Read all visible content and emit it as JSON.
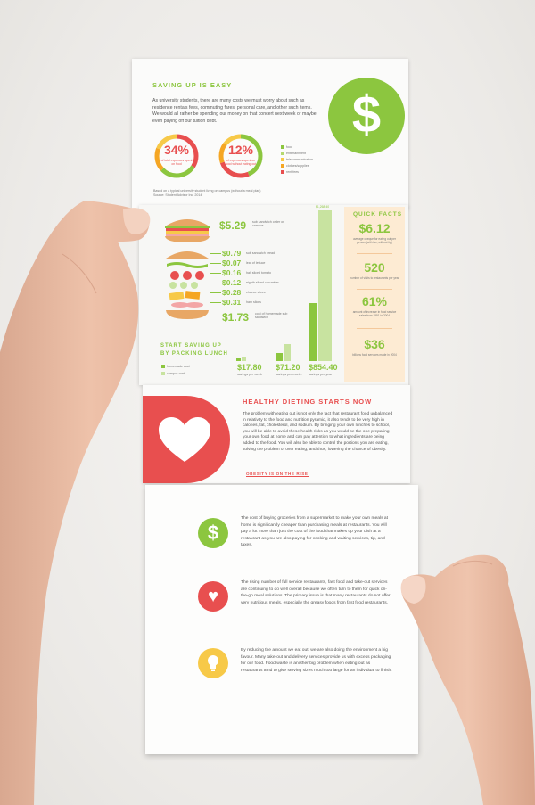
{
  "colors": {
    "green": "#8cc63f",
    "red": "#e84f4f",
    "orange": "#f5a623",
    "yellow": "#f7c948",
    "peach": "#fdebd3"
  },
  "saving": {
    "title": "SAVING UP IS EASY",
    "body": "As university students, there are many costs we must worry about such as residence rentals fees, commuting fares, personal care, and other such items. We would all rather be spending our money on that concert next week or maybe even paying off our tuition debt.",
    "icon": "dollar-icon",
    "icon_glyph": "$",
    "donut1_pct": "34%",
    "donut1_caption": "of total expenses spent on food",
    "donut2_pct": "12%",
    "donut2_caption": "of expenses spent on food without eating out",
    "legend": [
      "food",
      "entertainment",
      "telecommunication",
      "clothes/supplies",
      "rent fees"
    ],
    "footnote": "Based on a typical university student living on campus (without a meal plan) Source: Student Advisor Inc. 2014"
  },
  "sandwich": {
    "sub_price": "$5.29",
    "sub_label": "sub sandwich order on campus",
    "ingredients": [
      {
        "price": "$0.79",
        "label": "sub sandwich bread"
      },
      {
        "price": "$0.07",
        "label": "leaf of lettuce"
      },
      {
        "price": "$0.16",
        "label": "half sliced tomato"
      },
      {
        "price": "$0.12",
        "label": "eighth sliced cucumber"
      },
      {
        "price": "$0.28",
        "label": "cheese slices"
      },
      {
        "price": "$0.31",
        "label": "ham slices"
      }
    ],
    "home_price": "$1.73",
    "home_label": "cost of homemade sub sandwich"
  },
  "start_saving": {
    "title": "START SAVING UP BY PACKING LUNCH",
    "legend": [
      "homemade cost",
      "campus cost"
    ],
    "savings": [
      {
        "value": "$17.80",
        "label": "savings per week"
      },
      {
        "value": "$71.20",
        "label": "savings per month"
      },
      {
        "value": "$854.40",
        "label": "savings per year"
      }
    ],
    "top_label": "$1,268.40"
  },
  "quick_facts": {
    "title": "QUICK FACTS",
    "facts": [
      {
        "num": "$6.12",
        "text": "average cheque for eating out per person (with tax, without tip)"
      },
      {
        "num": "520",
        "text": "number of visits to restaurants per year"
      },
      {
        "num": "61%",
        "text": "amount of increase in food service sales from 1991 to 2004"
      },
      {
        "num": "$36",
        "text": "billions food services made in 2004"
      }
    ]
  },
  "healthy": {
    "title": "HEALTHY DIETING STARTS NOW",
    "icon": "heart-icon",
    "body": "The problem with eating out is not only the fact that restaurant food unbalanced in relativity to the food and nutrition pyramid, it also tends to be very high in calories, fat, cholesterol, and sodium. By bringing your own lunches to school, you will be able to avoid these health risks as you would be the one preparing your own food at home and can pay attention to what ingredients are being added to the food. You will also be able to control the portions you are eating, solving the problem of over eating, and thus, lowering the chance of obesity.",
    "subtitle": "OBESITY IS ON THE RISE"
  },
  "back": {
    "items": [
      {
        "icon": "dollar-icon",
        "glyph": "$",
        "text": "The cost of buying groceries from a supermarket to make your own meals at home is significantly cheaper than purchasing meals at restaurants. You will pay a lot more than just the cost of the food that makes up your dish at a restaurant as you are also paying for cooking and waiting services, tip, and taxes."
      },
      {
        "icon": "heart-icon",
        "glyph": "♥",
        "text": "The rising number of full service restaurants, fast food and take-out services are continuing to do well overall because we often turn to them for quick on-the-go meal solutions. The primary issue is that many restaurants do not offer very nutritious meals, especially the greasy foods from fast food restaurants."
      },
      {
        "icon": "lightbulb-icon",
        "glyph": "",
        "text": "By reducing the amount we eat out, we are also doing the environment a big favour. Many take-out and delivery services provide us with excess packaging for our food. Food waste is another big problem when eating out as restaurants tend to give serving sizes much too large for an individual to finish."
      }
    ]
  }
}
